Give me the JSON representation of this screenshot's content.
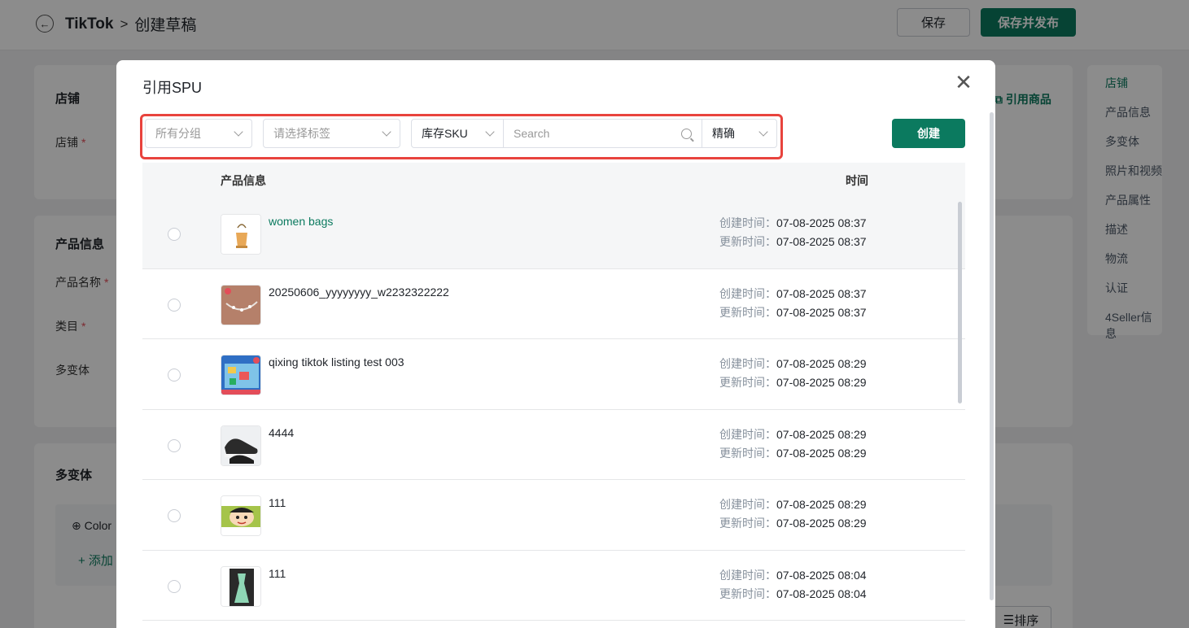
{
  "page": {
    "breadcrumb": {
      "app": "TikTok",
      "separator": ">",
      "current": "创建草稿"
    },
    "buttons": {
      "save": "保存",
      "publish": "保存并发布"
    },
    "cards": {
      "store": {
        "title": "店铺",
        "label": "店铺",
        "required": "*",
        "ref_link": "引用商品"
      },
      "product": {
        "title": "产品信息",
        "name_label": "产品名称",
        "category_label": "类目",
        "variants_label": "多变体",
        "required": "*"
      },
      "variants": {
        "title": "多变体",
        "color_label": "Color",
        "add_label": "+ 添加",
        "sort_label": "排序"
      }
    },
    "right_nav": [
      "店铺",
      "产品信息",
      "多变体",
      "照片和视频",
      "产品属性",
      "描述",
      "物流",
      "认证",
      "4Seller信息"
    ]
  },
  "modal": {
    "title": "引用SPU",
    "close_icon": "close-icon",
    "filters": {
      "group_placeholder": "所有分组",
      "tag_placeholder": "请选择标签",
      "search_field": "库存SKU",
      "search_placeholder": "Search",
      "match_mode": "精确"
    },
    "create_button": "创建",
    "table": {
      "headers": {
        "product": "产品信息",
        "time": "时间"
      },
      "created_label": "创建时间：",
      "updated_label": "更新时间：",
      "rows": [
        {
          "name": "women bags",
          "created": "07-08-2025 08:37",
          "updated": "07-08-2025 08:37",
          "thumb": "bag-thumbnail"
        },
        {
          "name": "20250606_yyyyyyyy_w2232322222",
          "created": "07-08-2025 08:37",
          "updated": "07-08-2025 08:37",
          "thumb": "bracelet-thumbnail"
        },
        {
          "name": "qixing tiktok listing test 003",
          "created": "07-08-2025 08:29",
          "updated": "07-08-2025 08:29",
          "thumb": "toy-box-thumbnail"
        },
        {
          "name": "4444",
          "created": "07-08-2025 08:29",
          "updated": "07-08-2025 08:29",
          "thumb": "sneaker-thumbnail"
        },
        {
          "name": "111",
          "created": "07-08-2025 08:29",
          "updated": "07-08-2025 08:29",
          "thumb": "cartoon-thumbnail"
        },
        {
          "name": "111",
          "created": "07-08-2025 08:04",
          "updated": "07-08-2025 08:04",
          "thumb": "dress-thumbnail"
        }
      ]
    }
  }
}
